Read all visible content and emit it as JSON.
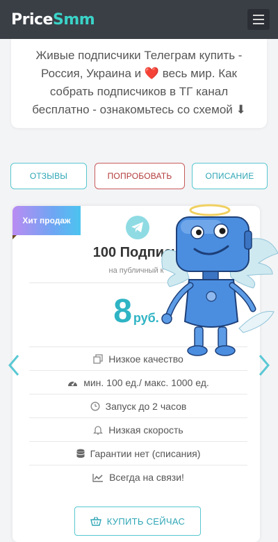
{
  "header": {
    "logo_part1": "Price",
    "logo_part2": "Smm",
    "menu_icon": "hamburger-icon"
  },
  "intro": {
    "text": "Живые подписчики Телеграм купить - Россия, Украина и ❤️ весь мир. Как собрать подписчиков в ТГ канал бесплатно - ознакомьтесь со схемой ⬇"
  },
  "tabs": [
    {
      "label": "ОТЗЫВЫ"
    },
    {
      "label": "ПОПРОБОВАТЬ"
    },
    {
      "label": "ОПИСАНИЕ"
    }
  ],
  "card": {
    "badge": "Хит продаж",
    "icon": "telegram-icon",
    "title": "100 Подписч",
    "subtitle": "на публичный к",
    "price_value": "8",
    "price_currency": "руб.",
    "features": [
      {
        "icon": "copy-icon",
        "text": "Низкое качество"
      },
      {
        "icon": "speedometer-icon",
        "text": "мин. 100 ед./ макс. 1000 ед."
      },
      {
        "icon": "clock-icon",
        "text": "Запуск до 2 часов"
      },
      {
        "icon": "bell-icon",
        "text": "Низкая скорость"
      },
      {
        "icon": "database-icon",
        "text": "Гарантии нет (списания)"
      },
      {
        "icon": "line-chart-icon",
        "text": "Всегда на связи!"
      }
    ],
    "buy_label": "КУПИТЬ СЕЙЧАС",
    "buy_icon": "basket-icon"
  },
  "nav": {
    "prev_icon": "chevron-left-icon",
    "next_icon": "chevron-right-icon"
  },
  "colors": {
    "accent": "#2fb4c4",
    "header_bg": "#3a3f46",
    "logo_accent": "#3ad3c8",
    "try_red": "#b33a3a"
  }
}
